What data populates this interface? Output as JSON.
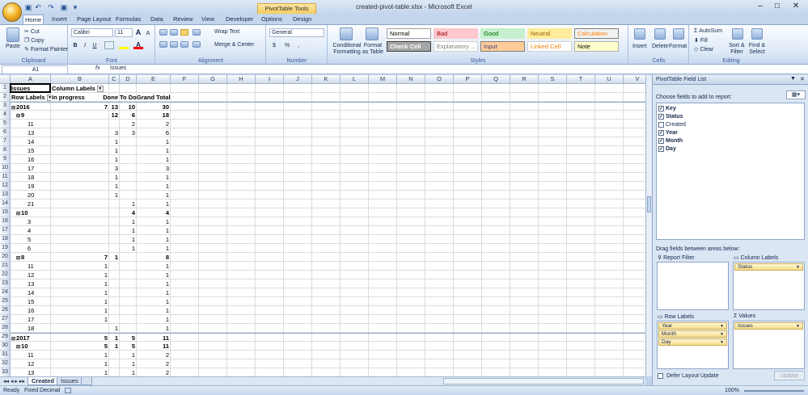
{
  "window": {
    "title": "created-pivot-table.xlsx - Microsoft Excel",
    "context_tab": "PivotTable Tools",
    "minimize": "–",
    "maximize": "□",
    "close": "✕"
  },
  "qat": {
    "save": "▣",
    "undo": "↶",
    "redo": "↷",
    "customize": "▾"
  },
  "ribbon": {
    "tabs": [
      "Home",
      "Insert",
      "Page Layout",
      "Formulas",
      "Data",
      "Review",
      "View",
      "Developer",
      "Options",
      "Design"
    ],
    "active_tab": "Home",
    "clipboard": {
      "paste": "Paste",
      "cut": "Cut",
      "copy": "Copy",
      "format_painter": "Format Painter",
      "group": "Clipboard"
    },
    "font": {
      "name": "Calibri",
      "size": "11",
      "group": "Font",
      "bold": "B",
      "italic": "I",
      "underline": "U",
      "grow": "A",
      "shrink": "A"
    },
    "alignment": {
      "wrap": "Wrap Text",
      "merge": "Merge & Center",
      "group": "Alignment"
    },
    "number": {
      "format": "General",
      "currency": "$",
      "percent": "%",
      "comma": ",",
      "group": "Number"
    },
    "styles": {
      "conditional": "Conditional Formatting",
      "format_table": "Format as Table",
      "group": "Styles",
      "cells": [
        {
          "label": "Normal",
          "bg": "#ffffff",
          "fg": "#000000",
          "border": "#a0a0a0"
        },
        {
          "label": "Bad",
          "bg": "#ffc7ce",
          "fg": "#9c0006",
          "border": "#ffc7ce"
        },
        {
          "label": "Good",
          "bg": "#c6efce",
          "fg": "#006100",
          "border": "#c6efce"
        },
        {
          "label": "Neutral",
          "bg": "#ffeb9c",
          "fg": "#9c6500",
          "border": "#ffeb9c"
        },
        {
          "label": "Calculation",
          "bg": "#f2f2f2",
          "fg": "#fa7d00",
          "border": "#7f7f7f"
        },
        {
          "label": "Check Cell",
          "bg": "#a5a5a5",
          "fg": "#ffffff",
          "border": "#3f3f3f"
        },
        {
          "label": "Explanatory ...",
          "bg": "#ffffff",
          "fg": "#7f7f7f",
          "border": "#d0d0d0"
        },
        {
          "label": "Input",
          "bg": "#ffcc99",
          "fg": "#3f3f76",
          "border": "#7f7f7f"
        },
        {
          "label": "Linked Cell",
          "bg": "#ffffff",
          "fg": "#fa7d00",
          "border": "#d0d0d0"
        },
        {
          "label": "Note",
          "bg": "#ffffcc",
          "fg": "#000000",
          "border": "#b2b2b2"
        }
      ]
    },
    "cells": {
      "insert": "Insert",
      "delete": "Delete",
      "format": "Format",
      "group": "Cells"
    },
    "editing": {
      "autosum": "AutoSum",
      "fill": "Fill",
      "clear": "Clear",
      "sort": "Sort & Filter",
      "find": "Find & Select",
      "group": "Editing"
    }
  },
  "formula_bar": {
    "name_box": "A1",
    "fx": "fx",
    "value": "Issues"
  },
  "columns": [
    "A",
    "B",
    "C",
    "D",
    "E",
    "F",
    "G",
    "H",
    "I",
    "J",
    "K",
    "L",
    "M",
    "N",
    "O",
    "P",
    "Q",
    "R",
    "S",
    "T",
    "U",
    "V"
  ],
  "rows": [
    {
      "n": "1",
      "a": "Issues",
      "b": "Column Labels",
      "c": "",
      "d": "",
      "e": "",
      "bold": true,
      "hdr": true,
      "dropB": true
    },
    {
      "n": "2",
      "a": "Row Labels",
      "b": "In progress",
      "c": "Done",
      "d": "To Do",
      "e": "Grand Total",
      "bold": true,
      "hdr": true,
      "dropA": true
    },
    {
      "n": "3",
      "a": "2016",
      "b": "7",
      "c": "13",
      "d": "10",
      "e": "30",
      "bold": true,
      "lvl": 0,
      "exp": true,
      "topline": true
    },
    {
      "n": "4",
      "a": "9",
      "b": "",
      "c": "12",
      "d": "6",
      "e": "18",
      "bold": true,
      "lvl": 1,
      "exp": true
    },
    {
      "n": "5",
      "a": "11",
      "b": "",
      "c": "",
      "d": "2",
      "e": "2",
      "lvl": 2
    },
    {
      "n": "6",
      "a": "13",
      "b": "",
      "c": "3",
      "d": "3",
      "e": "6",
      "lvl": 2
    },
    {
      "n": "7",
      "a": "14",
      "b": "",
      "c": "1",
      "d": "",
      "e": "1",
      "lvl": 2
    },
    {
      "n": "8",
      "a": "15",
      "b": "",
      "c": "1",
      "d": "",
      "e": "1",
      "lvl": 2
    },
    {
      "n": "9",
      "a": "16",
      "b": "",
      "c": "1",
      "d": "",
      "e": "1",
      "lvl": 2
    },
    {
      "n": "10",
      "a": "17",
      "b": "",
      "c": "3",
      "d": "",
      "e": "3",
      "lvl": 2
    },
    {
      "n": "11",
      "a": "18",
      "b": "",
      "c": "1",
      "d": "",
      "e": "1",
      "lvl": 2
    },
    {
      "n": "12",
      "a": "19",
      "b": "",
      "c": "1",
      "d": "",
      "e": "1",
      "lvl": 2
    },
    {
      "n": "13",
      "a": "20",
      "b": "",
      "c": "1",
      "d": "",
      "e": "1",
      "lvl": 2
    },
    {
      "n": "14",
      "a": "21",
      "b": "",
      "c": "",
      "d": "1",
      "e": "1",
      "lvl": 2
    },
    {
      "n": "15",
      "a": "10",
      "b": "",
      "c": "",
      "d": "4",
      "e": "4",
      "bold": true,
      "lvl": 1,
      "exp": true
    },
    {
      "n": "16",
      "a": "3",
      "b": "",
      "c": "",
      "d": "1",
      "e": "1",
      "lvl": 2
    },
    {
      "n": "17",
      "a": "4",
      "b": "",
      "c": "",
      "d": "1",
      "e": "1",
      "lvl": 2
    },
    {
      "n": "18",
      "a": "5",
      "b": "",
      "c": "",
      "d": "1",
      "e": "1",
      "lvl": 2
    },
    {
      "n": "19",
      "a": "6",
      "b": "",
      "c": "",
      "d": "1",
      "e": "1",
      "lvl": 2
    },
    {
      "n": "20",
      "a": "8",
      "b": "7",
      "c": "1",
      "d": "",
      "e": "8",
      "bold": true,
      "lvl": 1,
      "exp": true
    },
    {
      "n": "21",
      "a": "11",
      "b": "1",
      "c": "",
      "d": "",
      "e": "1",
      "lvl": 2
    },
    {
      "n": "22",
      "a": "12",
      "b": "1",
      "c": "",
      "d": "",
      "e": "1",
      "lvl": 2
    },
    {
      "n": "23",
      "a": "13",
      "b": "1",
      "c": "",
      "d": "",
      "e": "1",
      "lvl": 2
    },
    {
      "n": "24",
      "a": "14",
      "b": "1",
      "c": "",
      "d": "",
      "e": "1",
      "lvl": 2
    },
    {
      "n": "25",
      "a": "15",
      "b": "1",
      "c": "",
      "d": "",
      "e": "1",
      "lvl": 2
    },
    {
      "n": "26",
      "a": "16",
      "b": "1",
      "c": "",
      "d": "",
      "e": "1",
      "lvl": 2
    },
    {
      "n": "27",
      "a": "17",
      "b": "1",
      "c": "",
      "d": "",
      "e": "1",
      "lvl": 2
    },
    {
      "n": "28",
      "a": "18",
      "b": "",
      "c": "1",
      "d": "",
      "e": "1",
      "lvl": 2
    },
    {
      "n": "29",
      "a": "2017",
      "b": "5",
      "c": "1",
      "d": "5",
      "e": "11",
      "bold": true,
      "lvl": 0,
      "exp": true,
      "topline": true
    },
    {
      "n": "30",
      "a": "10",
      "b": "5",
      "c": "1",
      "d": "5",
      "e": "11",
      "bold": true,
      "lvl": 1,
      "exp": true
    },
    {
      "n": "31",
      "a": "11",
      "b": "1",
      "c": "",
      "d": "1",
      "e": "2",
      "lvl": 2
    },
    {
      "n": "32",
      "a": "12",
      "b": "1",
      "c": "",
      "d": "1",
      "e": "2",
      "lvl": 2
    },
    {
      "n": "33",
      "a": "13",
      "b": "1",
      "c": "",
      "d": "1",
      "e": "2",
      "lvl": 2
    }
  ],
  "sheet_tabs": [
    "Created",
    "Issues"
  ],
  "status": {
    "ready": "Ready",
    "fixed": "Fixed Decimal",
    "zoom": "100%"
  },
  "pivot_panel": {
    "title": "PivotTable Field List",
    "choose": "Choose fields to add to report:",
    "fields": [
      {
        "label": "Key",
        "checked": true
      },
      {
        "label": "Status",
        "checked": true
      },
      {
        "label": "Created",
        "checked": false
      },
      {
        "label": "Year",
        "checked": true
      },
      {
        "label": "Month",
        "checked": true
      },
      {
        "label": "Day",
        "checked": true
      }
    ],
    "drag": "Drag fields between areas below:",
    "report_filter": "Report Filter",
    "column_labels": "Column Labels",
    "row_labels": "Row Labels",
    "values": "Values",
    "column_items": [
      "Status"
    ],
    "row_items": [
      "Year",
      "Month",
      "Day"
    ],
    "value_items": [
      "Issues"
    ],
    "defer": "Defer Layout Update",
    "update": "Update"
  }
}
